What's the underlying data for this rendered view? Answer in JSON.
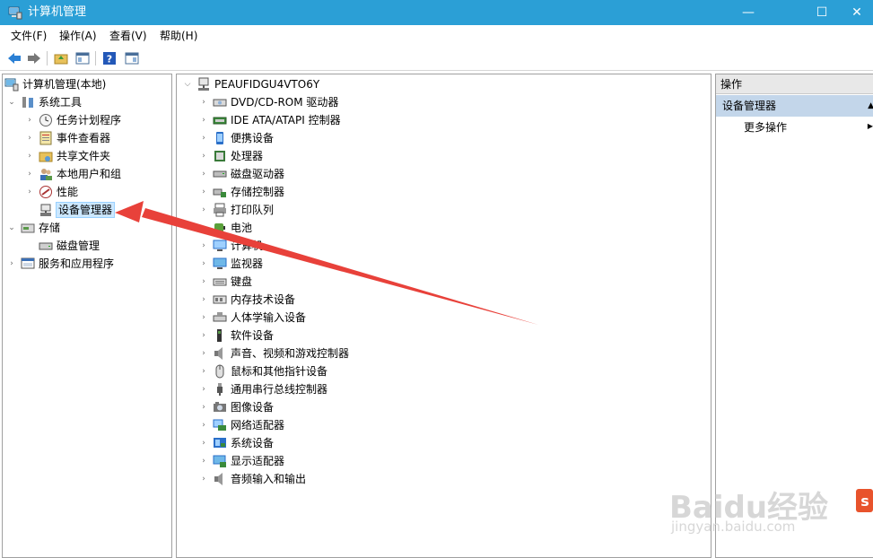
{
  "window": {
    "title": "计算机管理",
    "minimize": "—",
    "maximize": "☐",
    "close": "✕"
  },
  "menu": [
    "文件(F)",
    "操作(A)",
    "查看(V)",
    "帮助(H)"
  ],
  "left_tree": [
    {
      "label": "计算机管理(本地)",
      "level": 0,
      "arrow": "",
      "icon": "computer-management-icon"
    },
    {
      "label": "系统工具",
      "level": 1,
      "arrow": "expanded",
      "icon": "tools-icon"
    },
    {
      "label": "任务计划程序",
      "level": 2,
      "arrow": "collapsed",
      "icon": "clock-icon"
    },
    {
      "label": "事件查看器",
      "level": 2,
      "arrow": "collapsed",
      "icon": "event-viewer-icon"
    },
    {
      "label": "共享文件夹",
      "level": 2,
      "arrow": "collapsed",
      "icon": "shared-folder-icon"
    },
    {
      "label": "本地用户和组",
      "level": 2,
      "arrow": "collapsed",
      "icon": "users-icon"
    },
    {
      "label": "性能",
      "level": 2,
      "arrow": "collapsed",
      "icon": "performance-icon"
    },
    {
      "label": "设备管理器",
      "level": 2,
      "arrow": "",
      "icon": "device-manager-icon",
      "selected": true
    },
    {
      "label": "存储",
      "level": 1,
      "arrow": "expanded",
      "icon": "storage-icon"
    },
    {
      "label": "磁盘管理",
      "level": 2,
      "arrow": "",
      "icon": "disk-management-icon"
    },
    {
      "label": "服务和应用程序",
      "level": 1,
      "arrow": "collapsed",
      "icon": "services-icon"
    }
  ],
  "device_tree": {
    "root": "PEAUFIDGU4VTO6Y",
    "items": [
      {
        "label": "DVD/CD-ROM 驱动器",
        "icon": "dvd-drive-icon"
      },
      {
        "label": "IDE ATA/ATAPI 控制器",
        "icon": "ide-controller-icon"
      },
      {
        "label": "便携设备",
        "icon": "portable-device-icon"
      },
      {
        "label": "处理器",
        "icon": "processor-icon"
      },
      {
        "label": "磁盘驱动器",
        "icon": "disk-drive-icon"
      },
      {
        "label": "存储控制器",
        "icon": "storage-controller-icon"
      },
      {
        "label": "打印队列",
        "icon": "printer-icon"
      },
      {
        "label": "电池",
        "icon": "battery-icon"
      },
      {
        "label": "计算机",
        "icon": "computer-icon"
      },
      {
        "label": "监视器",
        "icon": "monitor-icon"
      },
      {
        "label": "键盘",
        "icon": "keyboard-icon"
      },
      {
        "label": "内存技术设备",
        "icon": "memory-device-icon"
      },
      {
        "label": "人体学输入设备",
        "icon": "hid-icon"
      },
      {
        "label": "软件设备",
        "icon": "software-device-icon"
      },
      {
        "label": "声音、视频和游戏控制器",
        "icon": "speaker-icon"
      },
      {
        "label": "鼠标和其他指针设备",
        "icon": "mouse-icon"
      },
      {
        "label": "通用串行总线控制器",
        "icon": "usb-icon"
      },
      {
        "label": "图像设备",
        "icon": "camera-icon"
      },
      {
        "label": "网络适配器",
        "icon": "network-adapter-icon"
      },
      {
        "label": "系统设备",
        "icon": "system-device-icon"
      },
      {
        "label": "显示适配器",
        "icon": "display-adapter-icon"
      },
      {
        "label": "音频输入和输出",
        "icon": "audio-io-icon"
      }
    ]
  },
  "actions": {
    "header": "操作",
    "section": "设备管理器",
    "more": "更多操作"
  },
  "watermark": {
    "brand": "Baidu经验",
    "url": "jingyan.baidu.com"
  },
  "colors": {
    "titlebar": "#2b9fd6",
    "selection": "#cce8ff",
    "annotation_arrow": "#e8413a"
  }
}
